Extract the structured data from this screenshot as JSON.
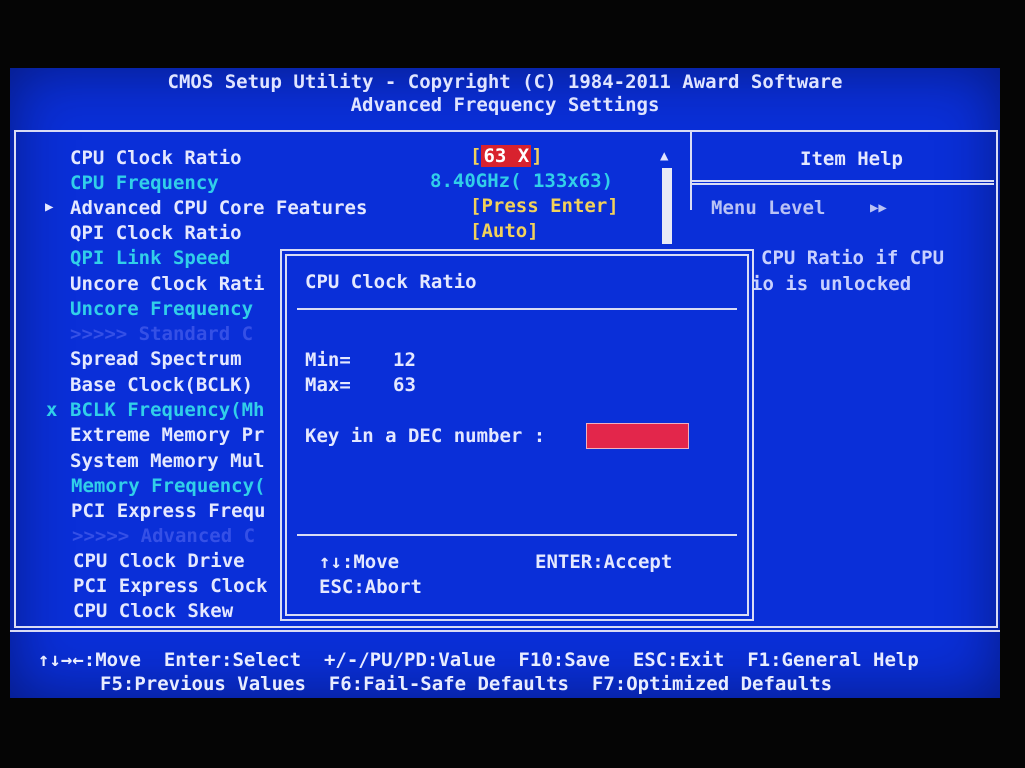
{
  "header": {
    "line1": "CMOS Setup Utility - Copyright (C) 1984-2011 Award Software",
    "line2": "Advanced Frequency Settings"
  },
  "menu": {
    "items": [
      {
        "label": "CPU Clock Ratio",
        "value": "[63 X]",
        "state": "selected"
      },
      {
        "label": "CPU Frequency",
        "value": "8.40GHz( 133x63)",
        "state": "info"
      },
      {
        "marker": "▶",
        "label": "Advanced CPU Core Features",
        "value": "[Press Enter]",
        "state": "normal"
      },
      {
        "label": "QPI Clock Ratio",
        "value": "[Auto]",
        "state": "normal"
      },
      {
        "label": "QPI Link Speed",
        "state": "info"
      },
      {
        "label": "Uncore Clock Rati",
        "state": "normal"
      },
      {
        "label": "Uncore Frequency",
        "state": "info"
      },
      {
        "label": ">>>>> Standard C",
        "state": "dim"
      },
      {
        "label": "Spread Spectrum",
        "state": "normal"
      },
      {
        "label": "Base Clock(BCLK)",
        "state": "normal"
      },
      {
        "marker": "x",
        "label": "BCLK Frequency(Mh",
        "state": "info"
      },
      {
        "label": "Extreme Memory Pr",
        "state": "normal"
      },
      {
        "label": "System Memory Mul",
        "state": "normal"
      },
      {
        "label": "Memory Frequency(",
        "state": "info"
      },
      {
        "label": "PCI Express Frequ",
        "state": "normal"
      },
      {
        "label": ">>>>> Advanced C",
        "state": "dim"
      },
      {
        "label": "CPU Clock Drive",
        "state": "normal"
      },
      {
        "label": "PCI Express Clock",
        "state": "normal"
      },
      {
        "label": "CPU Clock Skew",
        "state": "normal"
      }
    ],
    "scroll_up_icon": "up-arrow"
  },
  "help": {
    "title": "Item Help",
    "menu_level_label": "Menu Level",
    "menu_level_value": "▶▶",
    "line1": "CPU Ratio if CPU",
    "line2": "io is unlocked"
  },
  "dialog": {
    "title": "CPU Clock Ratio",
    "min_label": "Min=",
    "min_value": "12",
    "max_label": "Max=",
    "max_value": "63",
    "prompt": "Key in a DEC number :",
    "input_value": "",
    "move_hint": "↑↓:Move",
    "accept_hint": "ENTER:Accept",
    "abort_hint": "ESC:Abort"
  },
  "footer": {
    "line1": "↑↓→←:Move  Enter:Select  +/-/PU/PD:Value  F10:Save  ESC:Exit  F1:General Help",
    "line2": "F5:Previous Values  F6:Fail-Safe Defaults  F7:Optimized Defaults"
  }
}
